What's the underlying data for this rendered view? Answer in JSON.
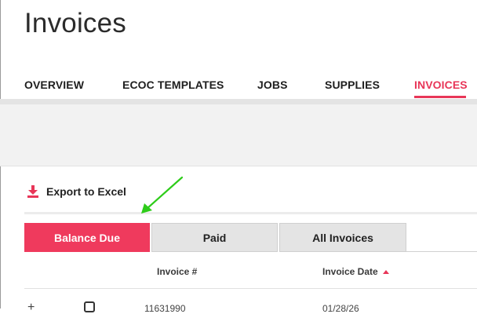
{
  "page": {
    "title": "Invoices"
  },
  "nav": {
    "tabs": [
      {
        "label": "OVERVIEW",
        "active": false
      },
      {
        "label": "ECOC TEMPLATES",
        "active": false
      },
      {
        "label": "JOBS",
        "active": false
      },
      {
        "label": "SUPPLIES",
        "active": false
      },
      {
        "label": "INVOICES",
        "active": true
      }
    ]
  },
  "toolbar": {
    "export_label": "Export to Excel",
    "export_icon": "download-icon"
  },
  "annotation": {
    "arrow_color": "#2ecc1a"
  },
  "filter_tabs": [
    {
      "label": "Balance Due",
      "active": true
    },
    {
      "label": "Paid",
      "active": false
    },
    {
      "label": "All Invoices",
      "active": false
    }
  ],
  "table": {
    "columns": [
      {
        "label": "Invoice #",
        "sorted": false
      },
      {
        "label": "Invoice Date",
        "sorted": true,
        "sort_direction": "ascending"
      }
    ],
    "rows": [
      {
        "expand": "+",
        "invoice_number": "11631990",
        "invoice_date": "01/28/26"
      }
    ]
  },
  "colors": {
    "accent": "#e83658",
    "active_tab_bg": "#ef3a5d",
    "inactive_tab_bg": "#e4e4e4"
  }
}
